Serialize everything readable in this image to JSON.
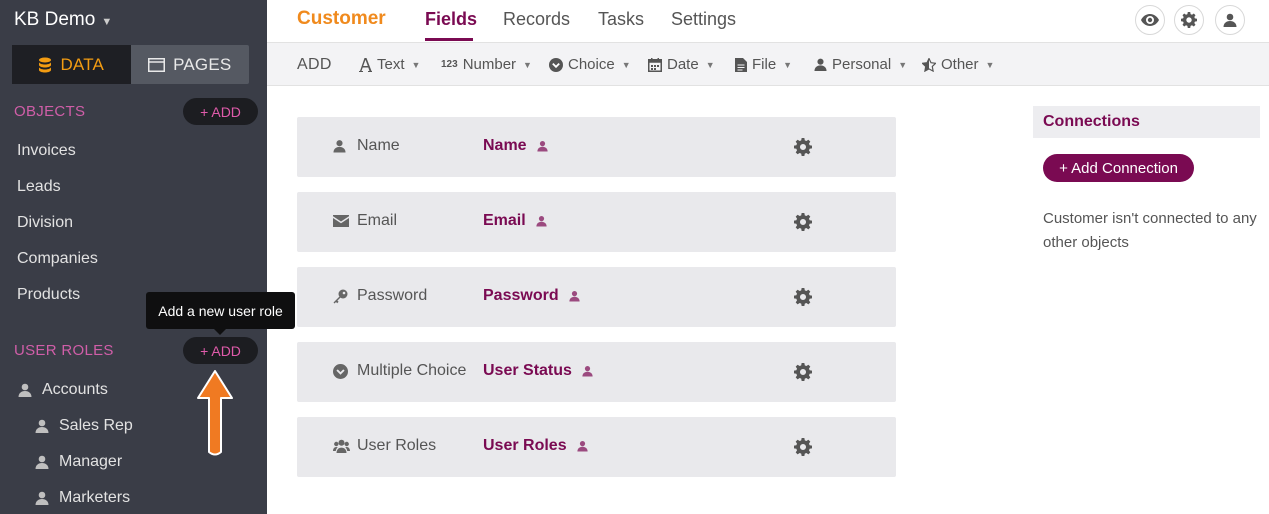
{
  "sidebar": {
    "app_title": "KB Demo",
    "seg_data": "DATA",
    "seg_pages": "PAGES",
    "objects_head": "OBJECTS",
    "add_label": "+ ADD",
    "objects": [
      "Invoices",
      "Leads",
      "Division",
      "Companies",
      "Products"
    ],
    "user_roles_head": "USER ROLES",
    "user_roles": [
      "Accounts",
      "Sales Rep",
      "Manager",
      "Marketers"
    ]
  },
  "tooltip": "Add a new user role",
  "topnav": {
    "object": "Customer",
    "tabs": [
      "Fields",
      "Records",
      "Tasks",
      "Settings"
    ]
  },
  "toolbar": {
    "add": "ADD",
    "items": [
      "Text",
      "Number",
      "Choice",
      "Date",
      "File",
      "Personal",
      "Other"
    ],
    "number_glyph": "123"
  },
  "fields": [
    {
      "type": "Name",
      "name": "Name",
      "icon": "user-icon"
    },
    {
      "type": "Email",
      "name": "Email",
      "icon": "envelope-icon"
    },
    {
      "type": "Password",
      "name": "Password",
      "icon": "key-icon"
    },
    {
      "type": "Multiple Choice",
      "name": "User Status",
      "icon": "chevron-circle-icon"
    },
    {
      "type": "User Roles",
      "name": "User Roles",
      "icon": "users-icon"
    }
  ],
  "connections": {
    "head": "Connections",
    "button": "+ Add Connection",
    "text": "Customer isn't connected to any other objects"
  },
  "colors": {
    "sidebar_bg": "#3a3d47",
    "accent_orange": "#f39c12",
    "brand_purple": "#7a0a52",
    "pink": "#d05ea8"
  }
}
